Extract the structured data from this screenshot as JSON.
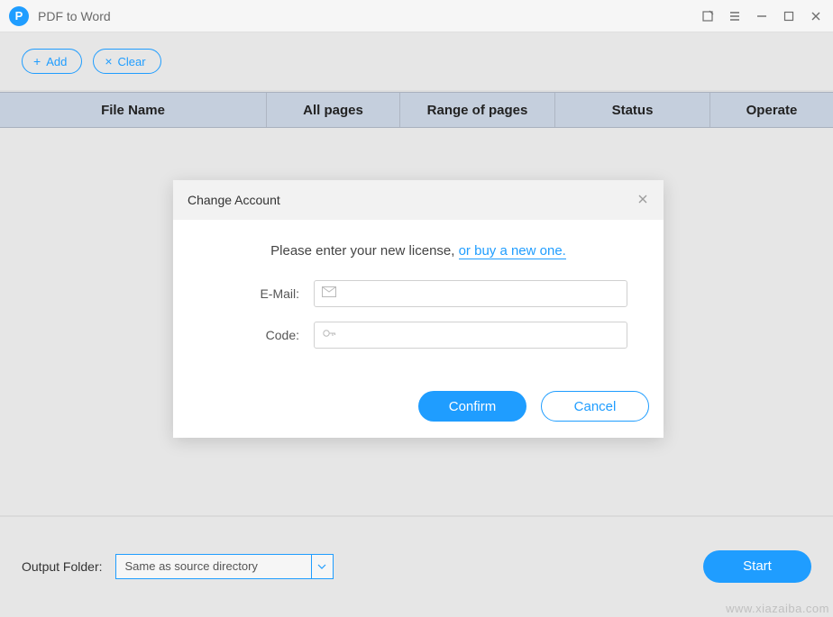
{
  "app": {
    "title": "PDF to Word",
    "logo_letter": "P"
  },
  "toolbar": {
    "add_label": "Add",
    "clear_label": "Clear"
  },
  "columns": {
    "name": "File Name",
    "all_pages": "All pages",
    "range": "Range of pages",
    "status": "Status",
    "operate": "Operate"
  },
  "footer": {
    "output_label": "Output Folder:",
    "select_value": "Same as source directory",
    "start_label": "Start"
  },
  "modal": {
    "title": "Change Account",
    "prompt_text": "Please enter your new license, ",
    "prompt_link": "or buy a new one.",
    "email_label": "E-Mail:",
    "code_label": "Code:",
    "email_value": "",
    "code_value": "",
    "confirm_label": "Confirm",
    "cancel_label": "Cancel"
  },
  "watermark": "www.xiazaiba.com"
}
